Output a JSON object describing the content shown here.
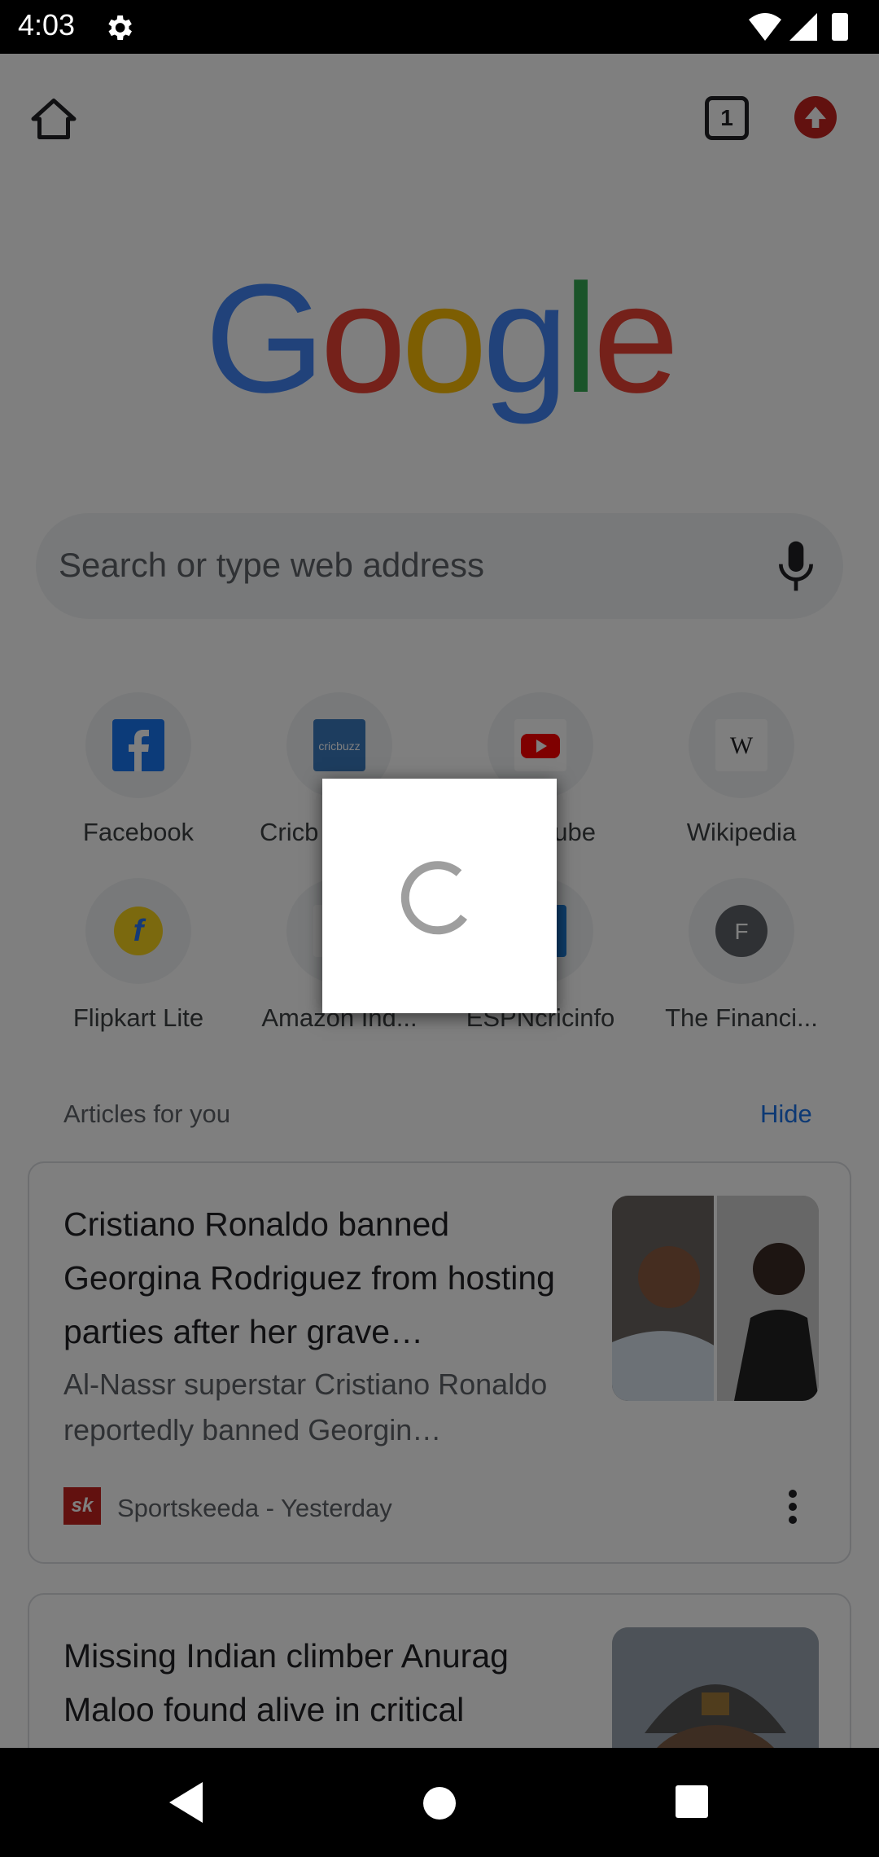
{
  "status_bar": {
    "time": "4:03"
  },
  "search": {
    "placeholder": "Search or type web address"
  },
  "toolbar": {
    "tab_count": "1"
  },
  "google_logo": {
    "letters": [
      "G",
      "o",
      "o",
      "g",
      "l",
      "e"
    ]
  },
  "tiles": [
    {
      "label": "Facebook",
      "icon": "facebook-icon"
    },
    {
      "label": "Cricb",
      "icon": "cricbuzz-icon"
    },
    {
      "label": "ube",
      "icon": "youtube-icon"
    },
    {
      "label": "Wikipedia",
      "icon": "wikipedia-icon"
    },
    {
      "label": "Flipkart Lite",
      "icon": "flipkart-icon"
    },
    {
      "label": "Amazon Ind...",
      "icon": "amazon-icon"
    },
    {
      "label": "ESPNcricinfo",
      "icon": "espncricinfo-icon"
    },
    {
      "label": "The Financi...",
      "icon": "financial-icon",
      "letter": "F"
    }
  ],
  "articles": {
    "header": "Articles for you",
    "hide_label": "Hide",
    "items": [
      {
        "title": "Cristiano Ronaldo banned Georgina Rodriguez from hosting parties after her grave…",
        "snippet": "Al-Nassr superstar Cristiano Ronaldo reportedly banned Georgin…",
        "source": "Sportskeeda - Yesterday",
        "source_logo": "sk"
      },
      {
        "title": "Missing Indian climber Anurag Maloo found alive in critical",
        "snippet": "",
        "source": ""
      }
    ]
  },
  "colors": {
    "accent": "#1a73e8",
    "scrim": "rgba(0,0,0,0.5)"
  }
}
